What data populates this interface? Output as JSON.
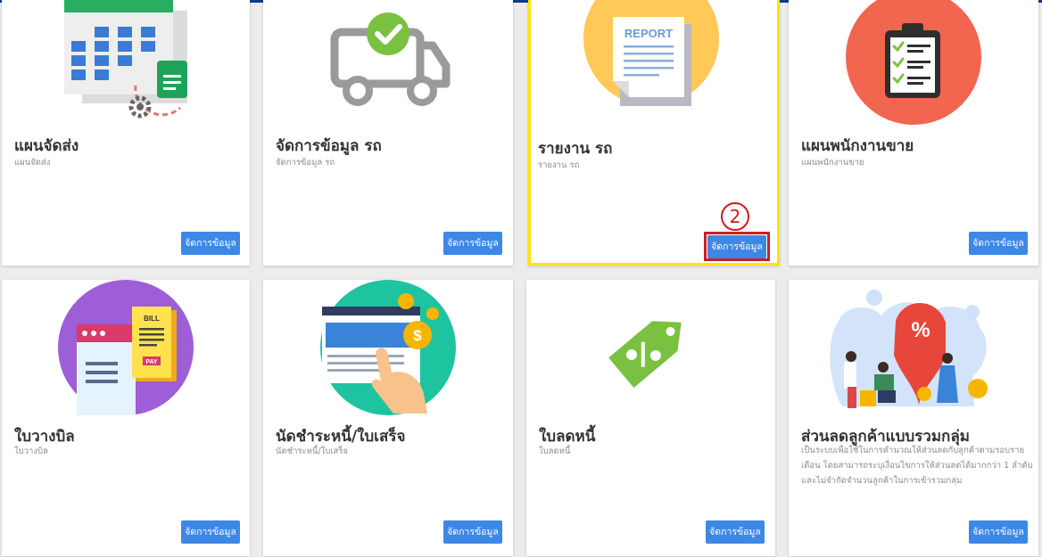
{
  "cards": [
    {
      "title": "แผนจัดส่ง",
      "subtitle": "แผนจัดส่ง",
      "button": "จัดการข้อมูล",
      "icon": "calendar-gear-icon"
    },
    {
      "title": "จัดการข้อมูล รถ",
      "subtitle": "จัดการข้อมูล รถ",
      "button": "จัดการข้อมูล",
      "icon": "truck-check-icon"
    },
    {
      "title": "รายงาน รถ",
      "subtitle": "รายงาน รถ",
      "button": "จัดการข้อมูล",
      "icon": "report-document-icon",
      "report_label": "REPORT"
    },
    {
      "title": "แผนพนักงานขาย",
      "subtitle": "แผนพนักงานขาย",
      "button": "จัดการข้อมูล",
      "icon": "clipboard-checklist-icon"
    },
    {
      "title": "ใบวางบิล",
      "subtitle": "ใบวางบิล",
      "button": "จัดการข้อมูล",
      "icon": "bill-invoice-icon",
      "bill_label": "BILL",
      "pay_label": "PAY"
    },
    {
      "title": "นัดชำระหนี้/ใบเสร็จ",
      "subtitle": "นัดชำระหนี้/ใบเสร็จ",
      "button": "จัดการข้อมูล",
      "icon": "online-payment-icon"
    },
    {
      "title": "ใบลดหนี้",
      "subtitle": "ใบลดหนี้",
      "button": "จัดการข้อมูล",
      "icon": "discount-tag-icon"
    },
    {
      "title": "ส่วนลดลูกค้าแบบรวมกลุ่ม",
      "subtitle_lines": [
        "เป็นระบบเพื่อใช้ในการคำนวณให้ส่วนลดกับลูกค้าตามรอบราย",
        "เดือน โดยสามารถระบุเงื่อนไขการให้ส่วนลดได้มากกว่า 1 ลำดับ",
        "และไม่จำกัดจำนวนลูกค้าในการเข้ารวมกลุ่ม"
      ],
      "button": "จัดการข้อมูล",
      "icon": "group-discount-icon"
    }
  ],
  "annotation": {
    "step_number": "2"
  },
  "colors": {
    "button": "#3d88e6",
    "highlight": "#ffe500",
    "step_marker": "#d21a1a"
  }
}
